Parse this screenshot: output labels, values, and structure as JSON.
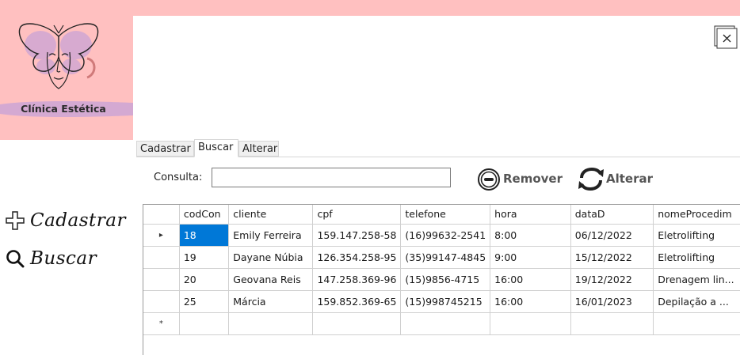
{
  "brand": {
    "name": "Clínica Estética",
    "bg_color": "#ffc0c0",
    "logo_icon": "butterfly-face-logo"
  },
  "sidebar": {
    "items": [
      {
        "label": "Cadastrar",
        "icon": "plus-icon"
      },
      {
        "label": "Buscar",
        "icon": "search-icon"
      }
    ]
  },
  "window": {
    "close_icon": "close-icon"
  },
  "tabs": [
    {
      "label": "Cadastrar",
      "active": false
    },
    {
      "label": "Buscar",
      "active": true
    },
    {
      "label": "Alterar",
      "active": false
    }
  ],
  "search": {
    "label": "Consulta:",
    "value": "",
    "placeholder": ""
  },
  "actions": {
    "remove_label": "Remover",
    "remove_icon": "minus-circle-icon",
    "alter_label": "Alterar",
    "alter_icon": "refresh-icon"
  },
  "grid": {
    "columns": [
      "codCon",
      "cliente",
      "cpf",
      "telefone",
      "hora",
      "dataD",
      "nomeProcedim"
    ],
    "rows": [
      {
        "marker": "▸",
        "cells": [
          "18",
          "Emily Ferreira",
          "159.147.258-58",
          "(16)99632-2541",
          "8:00",
          "06/12/2022",
          "Eletrolifting"
        ]
      },
      {
        "marker": "",
        "cells": [
          "19",
          "Dayane Núbia",
          "126.354.258-95",
          "(35)99147-4845",
          "9:00",
          "15/12/2022",
          "Eletrolifting"
        ]
      },
      {
        "marker": "",
        "cells": [
          "20",
          "Geovana Reis",
          "147.258.369-96",
          "(15)9856-4715",
          "16:00",
          "19/12/2022",
          "Drenagem lin..."
        ]
      },
      {
        "marker": "",
        "cells": [
          "25",
          "Márcia",
          "159.852.369-65",
          "(15)998745215",
          "16:00",
          "16/01/2023",
          "Depilação a ..."
        ]
      }
    ],
    "new_row_marker": "*",
    "selection_color": "#0078d7"
  }
}
